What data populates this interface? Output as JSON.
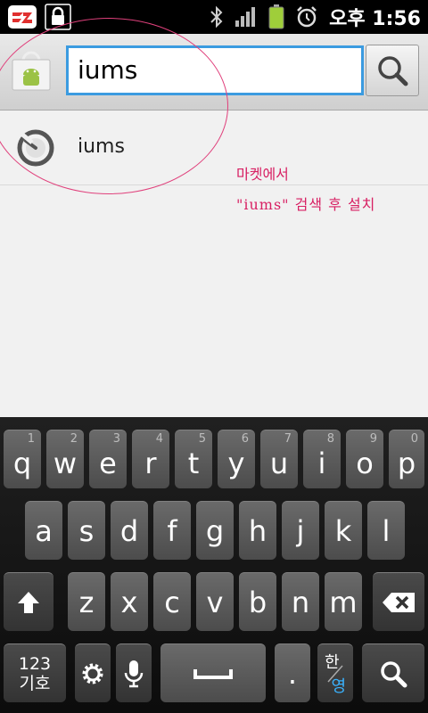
{
  "status_bar": {
    "time": "오후 1:56",
    "icons": [
      "app-icon",
      "lock-icon",
      "bluetooth-icon",
      "signal-icon",
      "battery-icon",
      "alarm-icon"
    ]
  },
  "search": {
    "query": "iums",
    "search_icon": "magnifier-icon"
  },
  "suggestions": [
    {
      "text": "iums",
      "icon": "history-icon"
    }
  ],
  "annotation": {
    "line1": "마켓에서",
    "line2": "\"iums\" 검색 후 설치",
    "color": "#d82063"
  },
  "keyboard": {
    "row1": [
      {
        "letter": "q",
        "number": "1"
      },
      {
        "letter": "w",
        "number": "2"
      },
      {
        "letter": "e",
        "number": "3"
      },
      {
        "letter": "r",
        "number": "4"
      },
      {
        "letter": "t",
        "number": "5"
      },
      {
        "letter": "y",
        "number": "6"
      },
      {
        "letter": "u",
        "number": "7"
      },
      {
        "letter": "i",
        "number": "8"
      },
      {
        "letter": "o",
        "number": "9"
      },
      {
        "letter": "p",
        "number": "0"
      }
    ],
    "row2": [
      "a",
      "s",
      "d",
      "f",
      "g",
      "h",
      "j",
      "k",
      "l"
    ],
    "row3": [
      "z",
      "x",
      "c",
      "v",
      "b",
      "n",
      "m"
    ],
    "symbols_label_top": "123",
    "symbols_label_bottom": "기호",
    "period": ".",
    "lang_han": "한",
    "lang_yeong": "영"
  }
}
